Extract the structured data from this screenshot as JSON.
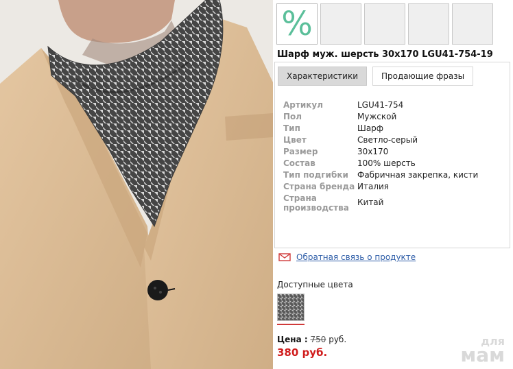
{
  "thumbnails": {
    "badge_symbol": "%"
  },
  "product": {
    "title": "Шарф муж. шерсть 30х170 LGU41-754-19"
  },
  "tabs": [
    {
      "label": "Характеристики"
    },
    {
      "label": "Продающие фразы"
    }
  ],
  "specs": [
    {
      "key": "Артикул",
      "value": "LGU41-754"
    },
    {
      "key": "Пол",
      "value": "Мужской"
    },
    {
      "key": "Тип",
      "value": "Шарф"
    },
    {
      "key": "Цвет",
      "value": "Светло-серый"
    },
    {
      "key": "Размер",
      "value": "30х170"
    },
    {
      "key": "Состав",
      "value": "100% шерсть"
    },
    {
      "key": "Тип подгибки",
      "value": "Фабричная закрепка, кисти"
    },
    {
      "key": "Страна бренда",
      "value": "Италия"
    },
    {
      "key": "Страна производства",
      "value": "Китай"
    }
  ],
  "feedback": {
    "label": "Обратная связь о продукте",
    "icon": "envelope-icon",
    "icon_color": "#d03a3a"
  },
  "colors": {
    "title": "Доступные цвета"
  },
  "price": {
    "label": "Цена :",
    "old_value": "750",
    "currency": "руб.",
    "new": "380 руб."
  },
  "watermark": {
    "line1": "для",
    "line2": "мам"
  }
}
